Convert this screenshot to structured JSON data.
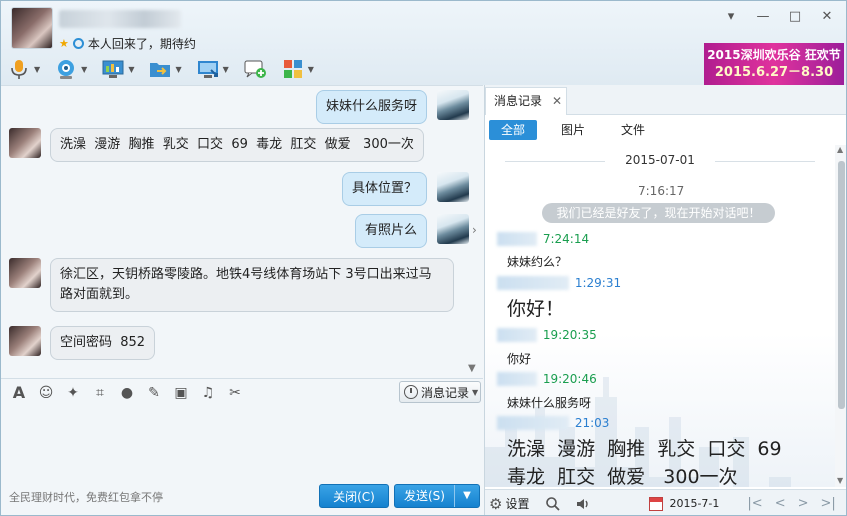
{
  "header": {
    "signature": "本人回来了，期待约",
    "window_controls": [
      "▾",
      "—",
      "□",
      "✕"
    ]
  },
  "toolbar": {
    "items": [
      "voice-call-icon",
      "video-call-icon",
      "screen-share-icon",
      "send-file-icon",
      "remote-desktop-icon",
      "send-sms-icon",
      "apps-icon"
    ]
  },
  "ad": {
    "line1": "2015深圳欢乐谷 狂欢节",
    "line2": "2015.6.27－8.30"
  },
  "chat": {
    "messages": [
      {
        "side": "me",
        "text": "妹妹什么服务呀"
      },
      {
        "side": "them",
        "text": "洗澡  漫游  胸推  乳交  口交  69  毒龙  肛交  做爱   300一次"
      },
      {
        "side": "me",
        "text": "具体位置？"
      },
      {
        "side": "me",
        "text": "有照片么"
      },
      {
        "side": "them",
        "text": "徐汇区，天钥桥路零陵路。地铁4号线体育场站下 3号口出来过马路对面就到。"
      },
      {
        "side": "them",
        "text": "空间密码  852"
      }
    ]
  },
  "input": {
    "history_label": "消息记录",
    "promo": "全民理财时代，免费红包拿不停",
    "close_label": "关闭(C)",
    "send_label": "发送(S)"
  },
  "history_panel": {
    "tab_label": "消息记录",
    "filters": [
      "全部",
      "图片",
      "文件"
    ],
    "date": "2015-07-01",
    "first_time": "7:16:17",
    "system_message": "我们已经是好友了，现在开始对话吧！",
    "entries": [
      {
        "time": "7:24:14",
        "text": "妹妹约么？",
        "big": false
      },
      {
        "time": "1:29:31",
        "text": "你好！",
        "big": true
      },
      {
        "time": "19:20:35",
        "text": "你好",
        "big": false
      },
      {
        "time": "19:20:46",
        "text": "妹妹什么服务呀",
        "big": false
      },
      {
        "time": "21:03",
        "text": "洗澡  漫游  胸推  乳交  口交  69",
        "text2": "毒龙  肛交  做爱   300一次",
        "big": true
      }
    ],
    "settings_label": "设置",
    "footer_date": "2015-7-1"
  }
}
